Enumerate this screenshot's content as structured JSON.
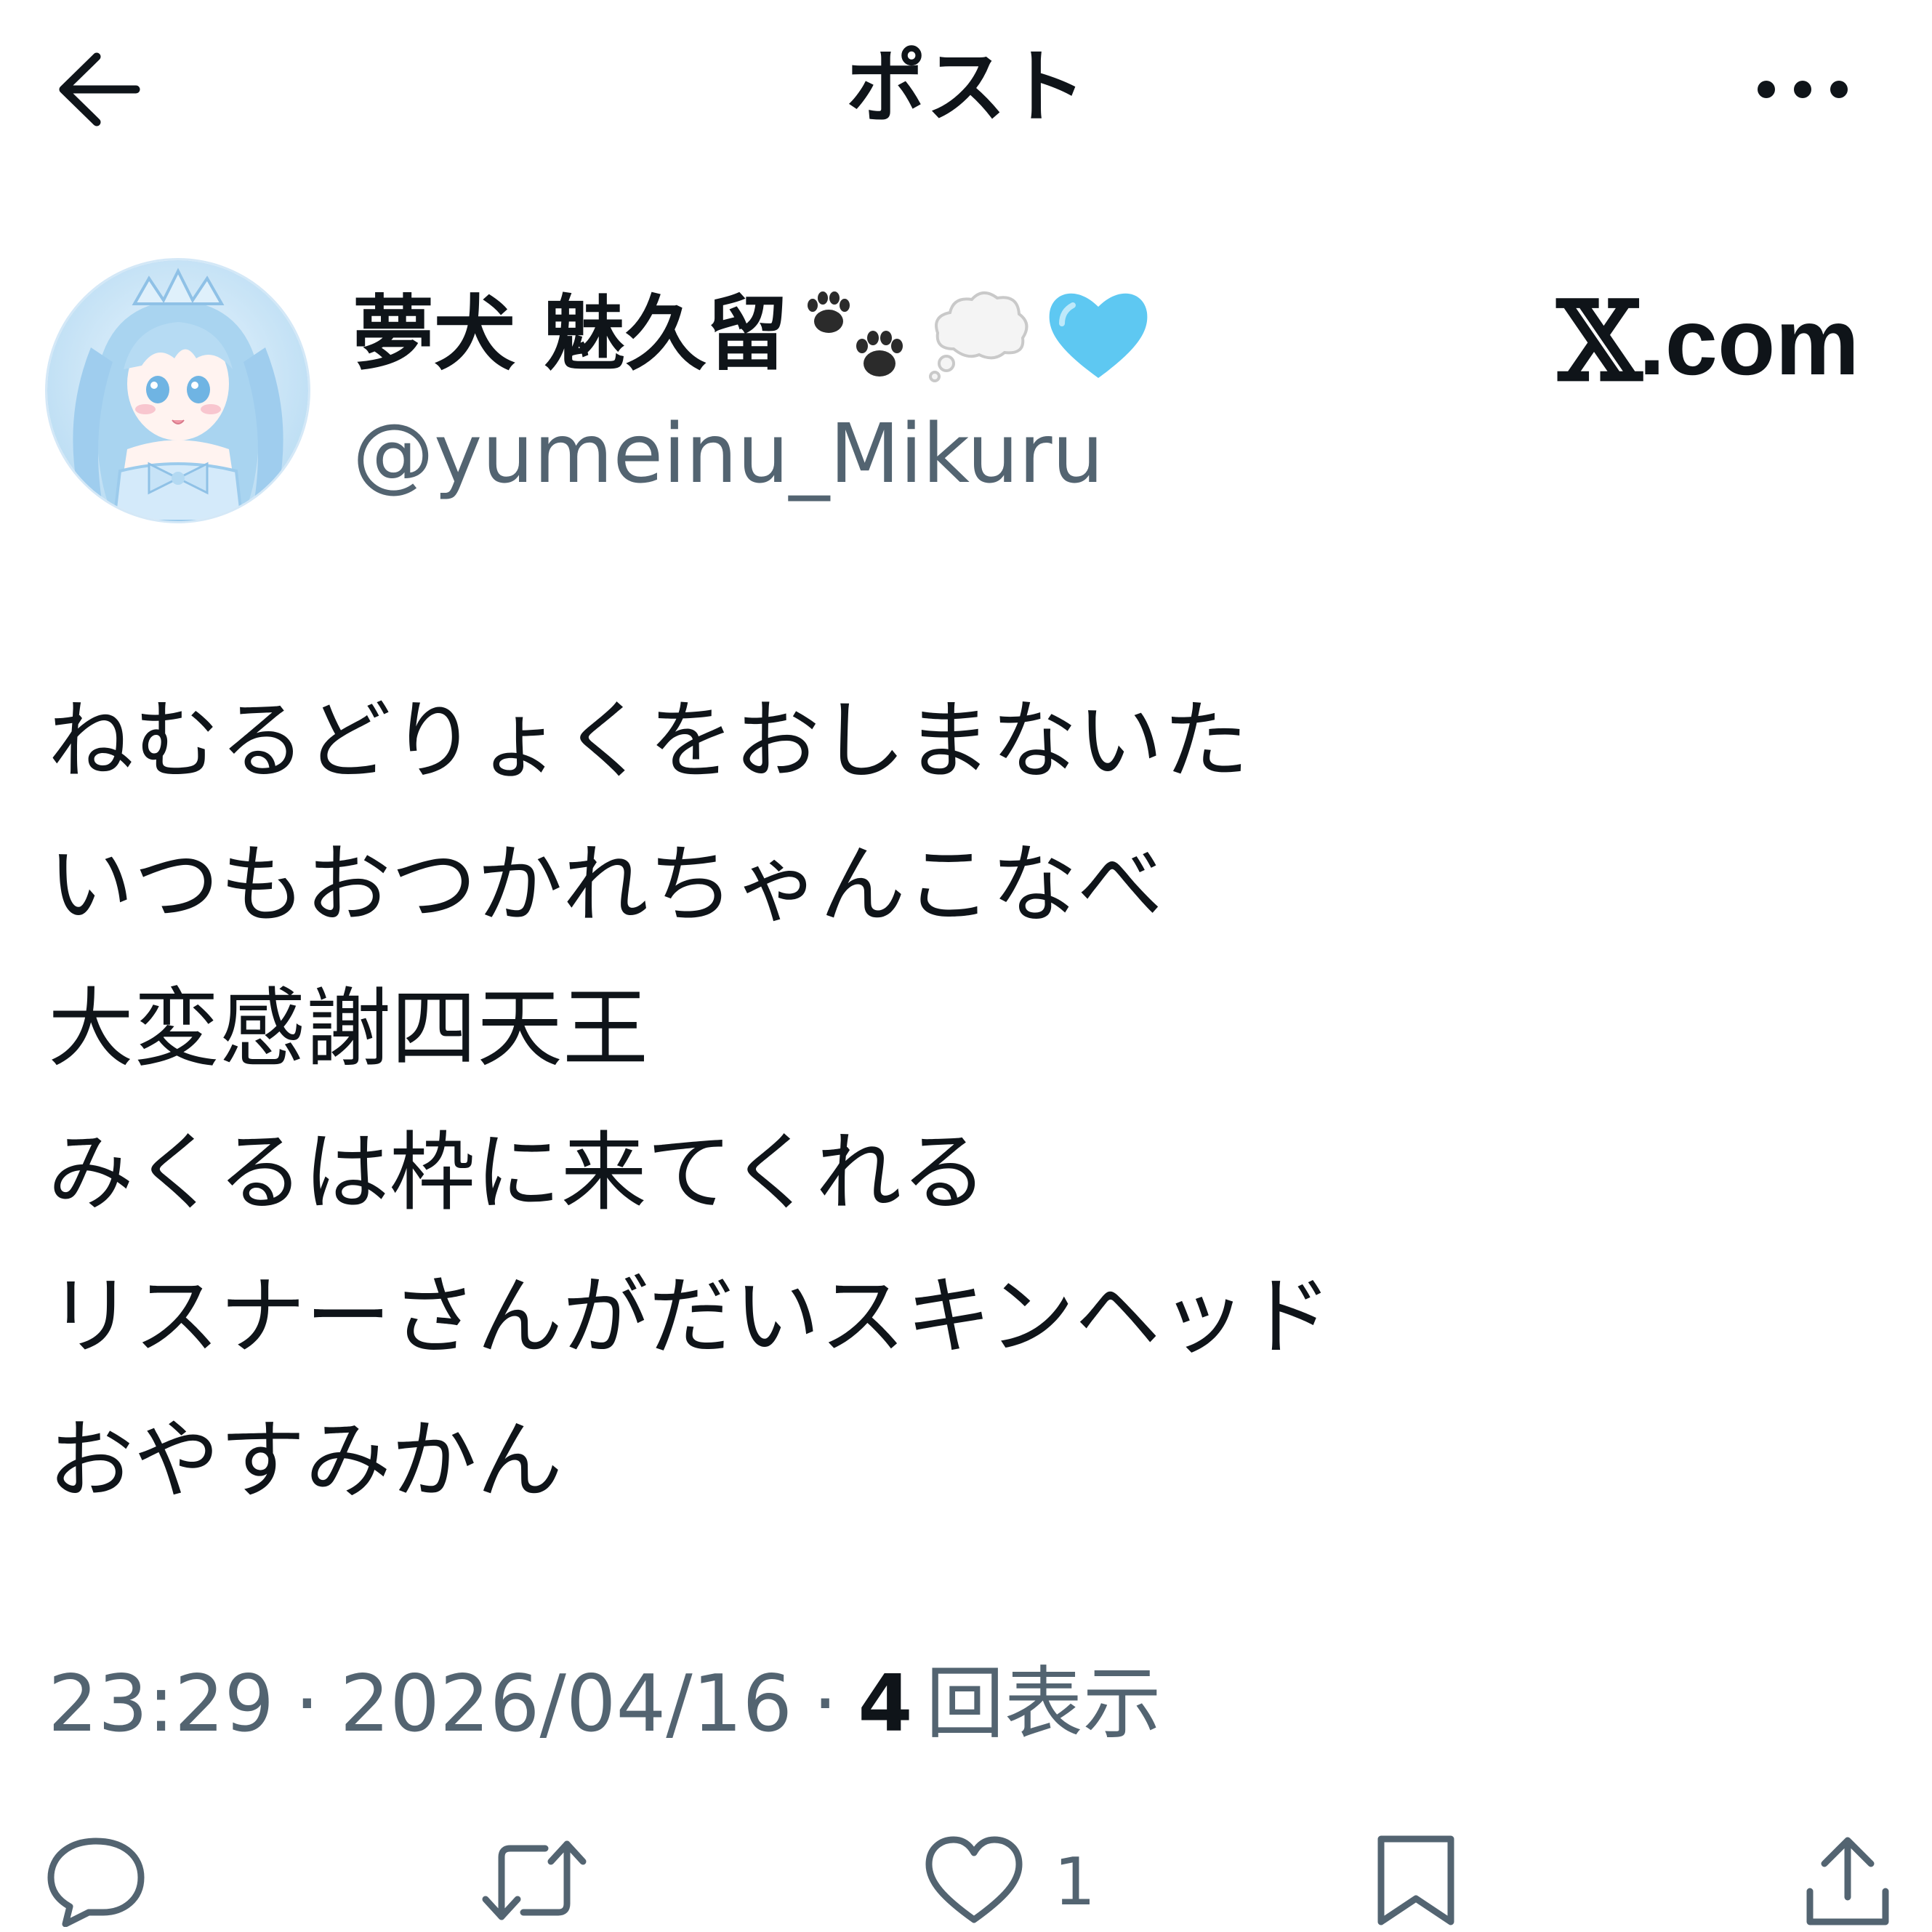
{
  "header": {
    "title": "ポスト",
    "back_icon": "arrow-left-icon",
    "more_icon": "more-horizontal-icon"
  },
  "author": {
    "display_name": "夢犬 魅久留",
    "name_emojis": [
      "paw-prints-icon",
      "thought-balloon-icon",
      "light-blue-heart-icon"
    ],
    "handle": "@yumeinu_Mikuru",
    "avatar_icon": "avatar-anime-girl",
    "brand": {
      "x": "𝕏",
      "suffix": ".com"
    }
  },
  "post": {
    "lines": [
      "ねむるどりょくをおしまないた",
      "いつもおつかれちゃんこなべ",
      "大変感謝四天王",
      "みくるは枠に来てくれる",
      "リスナーさんがだいスキンヘッド",
      "おやすみかん"
    ]
  },
  "meta": {
    "time": "23:29",
    "separator": "·",
    "date": "2026/04/16",
    "views_count": "4",
    "views_label": "回表示"
  },
  "actions": {
    "reply": {
      "icon": "reply-icon",
      "count": ""
    },
    "repost": {
      "icon": "repost-icon",
      "count": ""
    },
    "like": {
      "icon": "heart-outline-icon",
      "count": "1"
    },
    "bookmark": {
      "icon": "bookmark-icon",
      "count": ""
    },
    "share": {
      "icon": "share-icon",
      "count": ""
    }
  },
  "colors": {
    "text": "#0f1419",
    "secondary": "#536471",
    "avatar_bg": "#cfe6f7",
    "heart_emoji": "#5ec8f2"
  }
}
